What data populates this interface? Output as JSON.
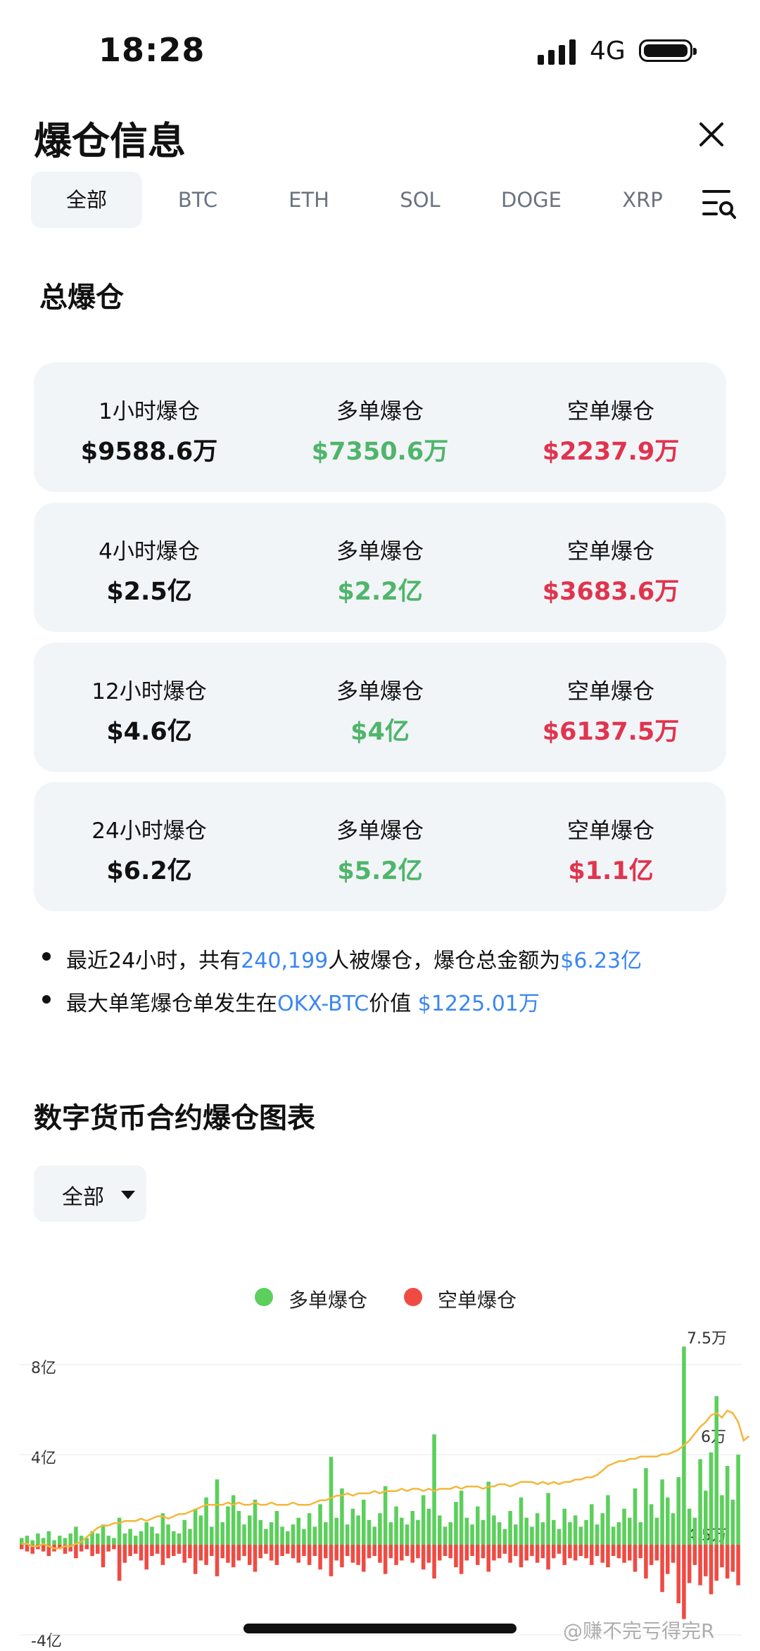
{
  "status_bar": {
    "time": "18:28",
    "network": "4G"
  },
  "header": {
    "title": "爆仓信息"
  },
  "tabs": [
    {
      "label": "全部",
      "active": true
    },
    {
      "label": "BTC",
      "active": false
    },
    {
      "label": "ETH",
      "active": false
    },
    {
      "label": "SOL",
      "active": false
    },
    {
      "label": "DOGE",
      "active": false
    },
    {
      "label": "XRP",
      "active": false
    }
  ],
  "total": {
    "title": "总爆仓",
    "rows": [
      {
        "period_label": "1小时爆仓",
        "total": "$9588.6万",
        "long_label": "多单爆仓",
        "long": "$7350.6万",
        "short_label": "空单爆仓",
        "short": "$2237.9万"
      },
      {
        "period_label": "4小时爆仓",
        "total": "$2.5亿",
        "long_label": "多单爆仓",
        "long": "$2.2亿",
        "short_label": "空单爆仓",
        "short": "$3683.6万"
      },
      {
        "period_label": "12小时爆仓",
        "total": "$4.6亿",
        "long_label": "多单爆仓",
        "long": "$4亿",
        "short_label": "空单爆仓",
        "short": "$6137.5万"
      },
      {
        "period_label": "24小时爆仓",
        "total": "$6.2亿",
        "long_label": "多单爆仓",
        "long": "$5.2亿",
        "short_label": "空单爆仓",
        "short": "$1.1亿"
      }
    ]
  },
  "notes": {
    "line1_a": "最近24小时，共有",
    "line1_people": "240,199",
    "line1_b": "人被爆仓，爆仓总金额为",
    "line1_amount": "$6.23亿",
    "line2_a": "最大单笔爆仓单发生在",
    "line2_exchange": "OKX-BTC",
    "line2_b": "价值 ",
    "line2_amount": "$1225.01万"
  },
  "chart_section": {
    "title": "数字货币合约爆仓图表",
    "filter_value": "全部"
  },
  "colors": {
    "long": "#5ccf5c",
    "short": "#ef4b43",
    "price_line": "#f4b73a",
    "accent": "#3a86f0"
  },
  "chart_data": {
    "type": "bar",
    "legend": [
      "多单爆仓",
      "空单爆仓"
    ],
    "y_left_ticks": [
      "8亿",
      "4亿",
      "-4亿"
    ],
    "y_right_ticks": [
      "7.5万",
      "6万",
      "4.5万"
    ],
    "ylim": [
      -4.5,
      9
    ],
    "series": [
      {
        "name": "多单爆仓",
        "values": [
          0.3,
          0.4,
          0.2,
          0.5,
          0.3,
          0.6,
          0.2,
          0.4,
          0.3,
          0.5,
          0.8,
          0.4,
          0.3,
          0.6,
          0.5,
          0.9,
          0.4,
          0.3,
          1.2,
          0.5,
          0.7,
          0.4,
          0.6,
          1.0,
          0.8,
          0.5,
          1.4,
          0.9,
          0.6,
          0.5,
          1.1,
          0.7,
          1.6,
          1.3,
          2.1,
          0.8,
          2.9,
          1.0,
          1.7,
          2.2,
          1.5,
          0.9,
          1.3,
          2.0,
          1.1,
          0.7,
          1.0,
          1.5,
          0.8,
          0.6,
          0.9,
          1.2,
          0.7,
          1.4,
          0.8,
          1.8,
          1.0,
          3.9,
          1.2,
          2.5,
          0.9,
          1.6,
          1.3,
          2.0,
          1.1,
          0.8,
          1.4,
          2.6,
          1.0,
          1.7,
          1.2,
          0.9,
          1.5,
          1.1,
          2.2,
          1.6,
          4.9,
          1.3,
          0.8,
          1.0,
          1.9,
          2.4,
          1.2,
          0.9,
          1.7,
          1.1,
          2.8,
          1.3,
          1.0,
          0.7,
          1.5,
          0.9,
          2.1,
          1.2,
          0.8,
          1.4,
          1.0,
          2.3,
          1.1,
          0.7,
          1.6,
          1.0,
          1.3,
          0.8,
          1.1,
          1.8,
          0.9,
          1.4,
          2.2,
          0.8,
          1.0,
          1.6,
          1.2,
          2.5,
          1.0,
          3.4,
          1.8,
          1.2,
          2.9,
          2.1,
          1.4,
          3.0,
          8.8,
          1.6,
          1.2,
          3.8,
          2.4,
          4.1,
          6.6,
          2.2,
          3.5,
          2.0,
          4.0
        ]
      },
      {
        "name": "空单爆仓",
        "values": [
          -0.2,
          -0.3,
          -0.4,
          -0.2,
          -0.3,
          -0.5,
          -0.3,
          -0.2,
          -0.4,
          -0.3,
          -0.6,
          -0.3,
          -0.2,
          -0.5,
          -0.4,
          -1.0,
          -0.3,
          -0.2,
          -1.6,
          -0.8,
          -0.5,
          -0.4,
          -0.7,
          -1.1,
          -0.5,
          -0.4,
          -0.9,
          -0.6,
          -0.5,
          -0.4,
          -0.8,
          -0.6,
          -1.3,
          -0.7,
          -0.9,
          -0.5,
          -1.4,
          -0.6,
          -0.8,
          -1.0,
          -0.7,
          -0.5,
          -0.9,
          -1.2,
          -0.6,
          -0.4,
          -0.7,
          -0.9,
          -0.5,
          -0.4,
          -0.6,
          -0.8,
          -0.5,
          -0.9,
          -0.5,
          -1.1,
          -0.6,
          -1.4,
          -0.7,
          -1.0,
          -0.5,
          -0.8,
          -0.9,
          -1.2,
          -0.6,
          -0.5,
          -0.8,
          -1.3,
          -0.6,
          -0.9,
          -0.7,
          -0.5,
          -0.8,
          -0.6,
          -1.1,
          -0.8,
          -1.5,
          -0.7,
          -0.5,
          -0.6,
          -1.0,
          -1.3,
          -0.7,
          -0.5,
          -0.9,
          -0.6,
          -1.2,
          -0.7,
          -0.6,
          -0.4,
          -0.8,
          -0.5,
          -1.0,
          -0.7,
          -0.5,
          -0.8,
          -0.6,
          -1.1,
          -0.6,
          -0.4,
          -0.9,
          -0.6,
          -0.7,
          -0.5,
          -0.6,
          -0.9,
          -0.5,
          -0.8,
          -1.0,
          -0.5,
          -0.6,
          -0.8,
          -0.7,
          -1.2,
          -0.6,
          -1.5,
          -0.9,
          -0.7,
          -2.1,
          -1.3,
          -0.8,
          -2.6,
          -3.3,
          -1.7,
          -0.9,
          -1.8,
          -1.4,
          -2.2,
          -1.6,
          -1.0,
          -1.5,
          -1.2,
          -1.8
        ]
      },
      {
        "name": "price",
        "values": [
          3.1,
          3.1,
          3.0,
          3.0,
          3.1,
          3.0,
          2.9,
          2.9,
          3.0,
          3.0,
          3.1,
          3.2,
          3.4,
          3.6,
          3.8,
          3.9,
          3.9,
          4.0,
          4.0,
          4.1,
          4.1,
          4.1,
          4.2,
          4.1,
          4.2,
          4.3,
          4.3,
          4.2,
          4.3,
          4.4,
          4.4,
          4.5,
          4.6,
          4.7,
          4.8,
          4.8,
          4.8,
          4.8,
          4.9,
          4.8,
          4.9,
          4.8,
          4.8,
          4.9,
          4.8,
          4.8,
          4.9,
          4.8,
          4.8,
          4.8,
          4.9,
          4.8,
          4.8,
          4.8,
          4.9,
          5.0,
          5.0,
          5.1,
          5.2,
          5.2,
          5.3,
          5.2,
          5.3,
          5.3,
          5.3,
          5.4,
          5.3,
          5.4,
          5.4,
          5.4,
          5.5,
          5.4,
          5.5,
          5.5,
          5.4,
          5.5,
          5.4,
          5.5,
          5.5,
          5.5,
          5.6,
          5.5,
          5.6,
          5.6,
          5.6,
          5.5,
          5.6,
          5.6,
          5.7,
          5.7,
          5.6,
          5.7,
          5.8,
          5.8,
          5.8,
          5.7,
          5.8,
          5.7,
          5.8,
          5.7,
          5.8,
          5.8,
          5.9,
          5.9,
          6.0,
          6.0,
          6.1,
          6.3,
          6.5,
          6.6,
          6.7,
          6.7,
          6.8,
          6.8,
          6.9,
          6.9,
          6.9,
          6.9,
          7.0,
          7.0,
          7.1,
          7.2,
          7.4,
          7.6,
          7.9,
          8.2,
          8.4,
          8.7,
          8.8,
          8.6,
          8.9,
          8.8,
          8.4,
          7.6,
          7.8
        ]
      }
    ]
  },
  "watermark": "@赚不完亏得完R"
}
